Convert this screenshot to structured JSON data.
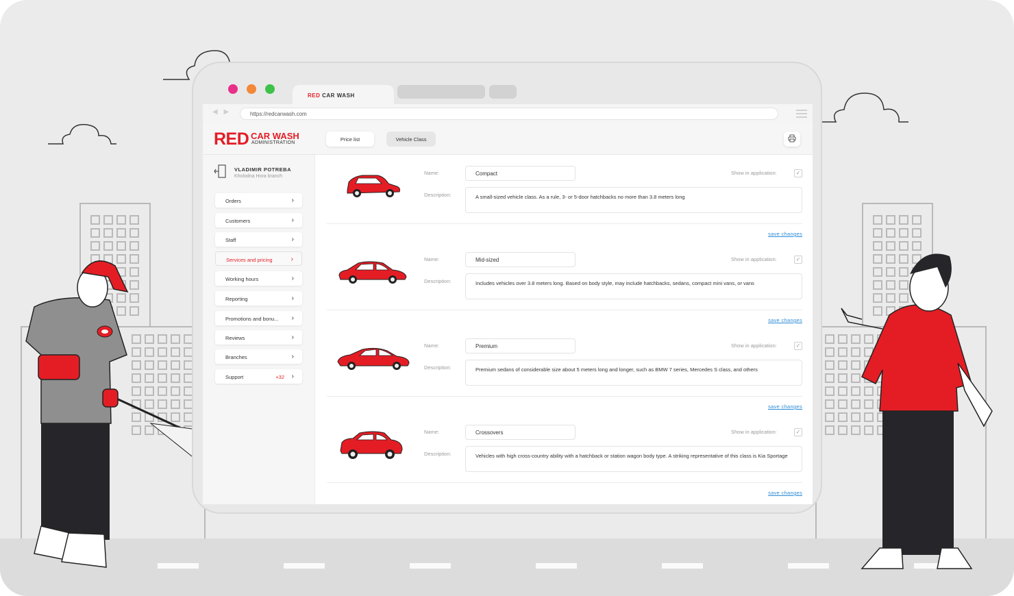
{
  "browser": {
    "tab_brand_red": "RED",
    "tab_brand_rest": "CAR WASH",
    "url": "https://redcarwash.com"
  },
  "header": {
    "logo_red": "RED",
    "logo_car_wash": "CAR WASH",
    "logo_admin": "ADMINISTRATION",
    "tabs": [
      {
        "label": "Price list"
      },
      {
        "label": "Vehicle Class"
      }
    ],
    "print_icon": "printer-icon"
  },
  "user": {
    "name": "VLADIMIR POTREBA",
    "branch": "Kholodna Hora branch"
  },
  "sidebar": {
    "items": [
      {
        "label": "Orders"
      },
      {
        "label": "Customers"
      },
      {
        "label": "Staff"
      },
      {
        "label": "Services and pricing",
        "active": true
      },
      {
        "label": "Working hours"
      },
      {
        "label": "Reporting"
      },
      {
        "label": "Promotions and bonu..."
      },
      {
        "label": "Reviews"
      },
      {
        "label": "Branches"
      },
      {
        "label": "Support",
        "badge": "+32"
      }
    ]
  },
  "form_labels": {
    "name": "Name:",
    "description": "Description:",
    "show": "Show in application:",
    "save": "save changes"
  },
  "vehicle_classes": [
    {
      "name": "Compact",
      "description": "A small-sized vehicle class. As a rule, 3- or 5-door hatchbacks no more than 3.8 meters long",
      "show": true,
      "car_icon": "hatchback-car-icon"
    },
    {
      "name": "Mid-sized",
      "description": "Includes vehicles over 3.8 meters long. Based on body style, may include hatchbacks, sedans, compact mini vans, or vans",
      "show": true,
      "car_icon": "sedan-car-icon"
    },
    {
      "name": "Premium",
      "description": "Premium sedans of considerable size about 5 meters long and longer, such as BMW 7 series, Mercedes S class, and others",
      "show": true,
      "car_icon": "premium-sedan-car-icon"
    },
    {
      "name": "Crossovers",
      "description": "Vehicles with high cross-country ability with a hatchback or station wagon body type. A striking representative of this class is Kia Sportage",
      "show": true,
      "car_icon": "crossover-car-icon"
    }
  ],
  "colors": {
    "brand_red": "#e41d25",
    "link_blue": "#2a8ad6",
    "background": "#ebebeb"
  }
}
